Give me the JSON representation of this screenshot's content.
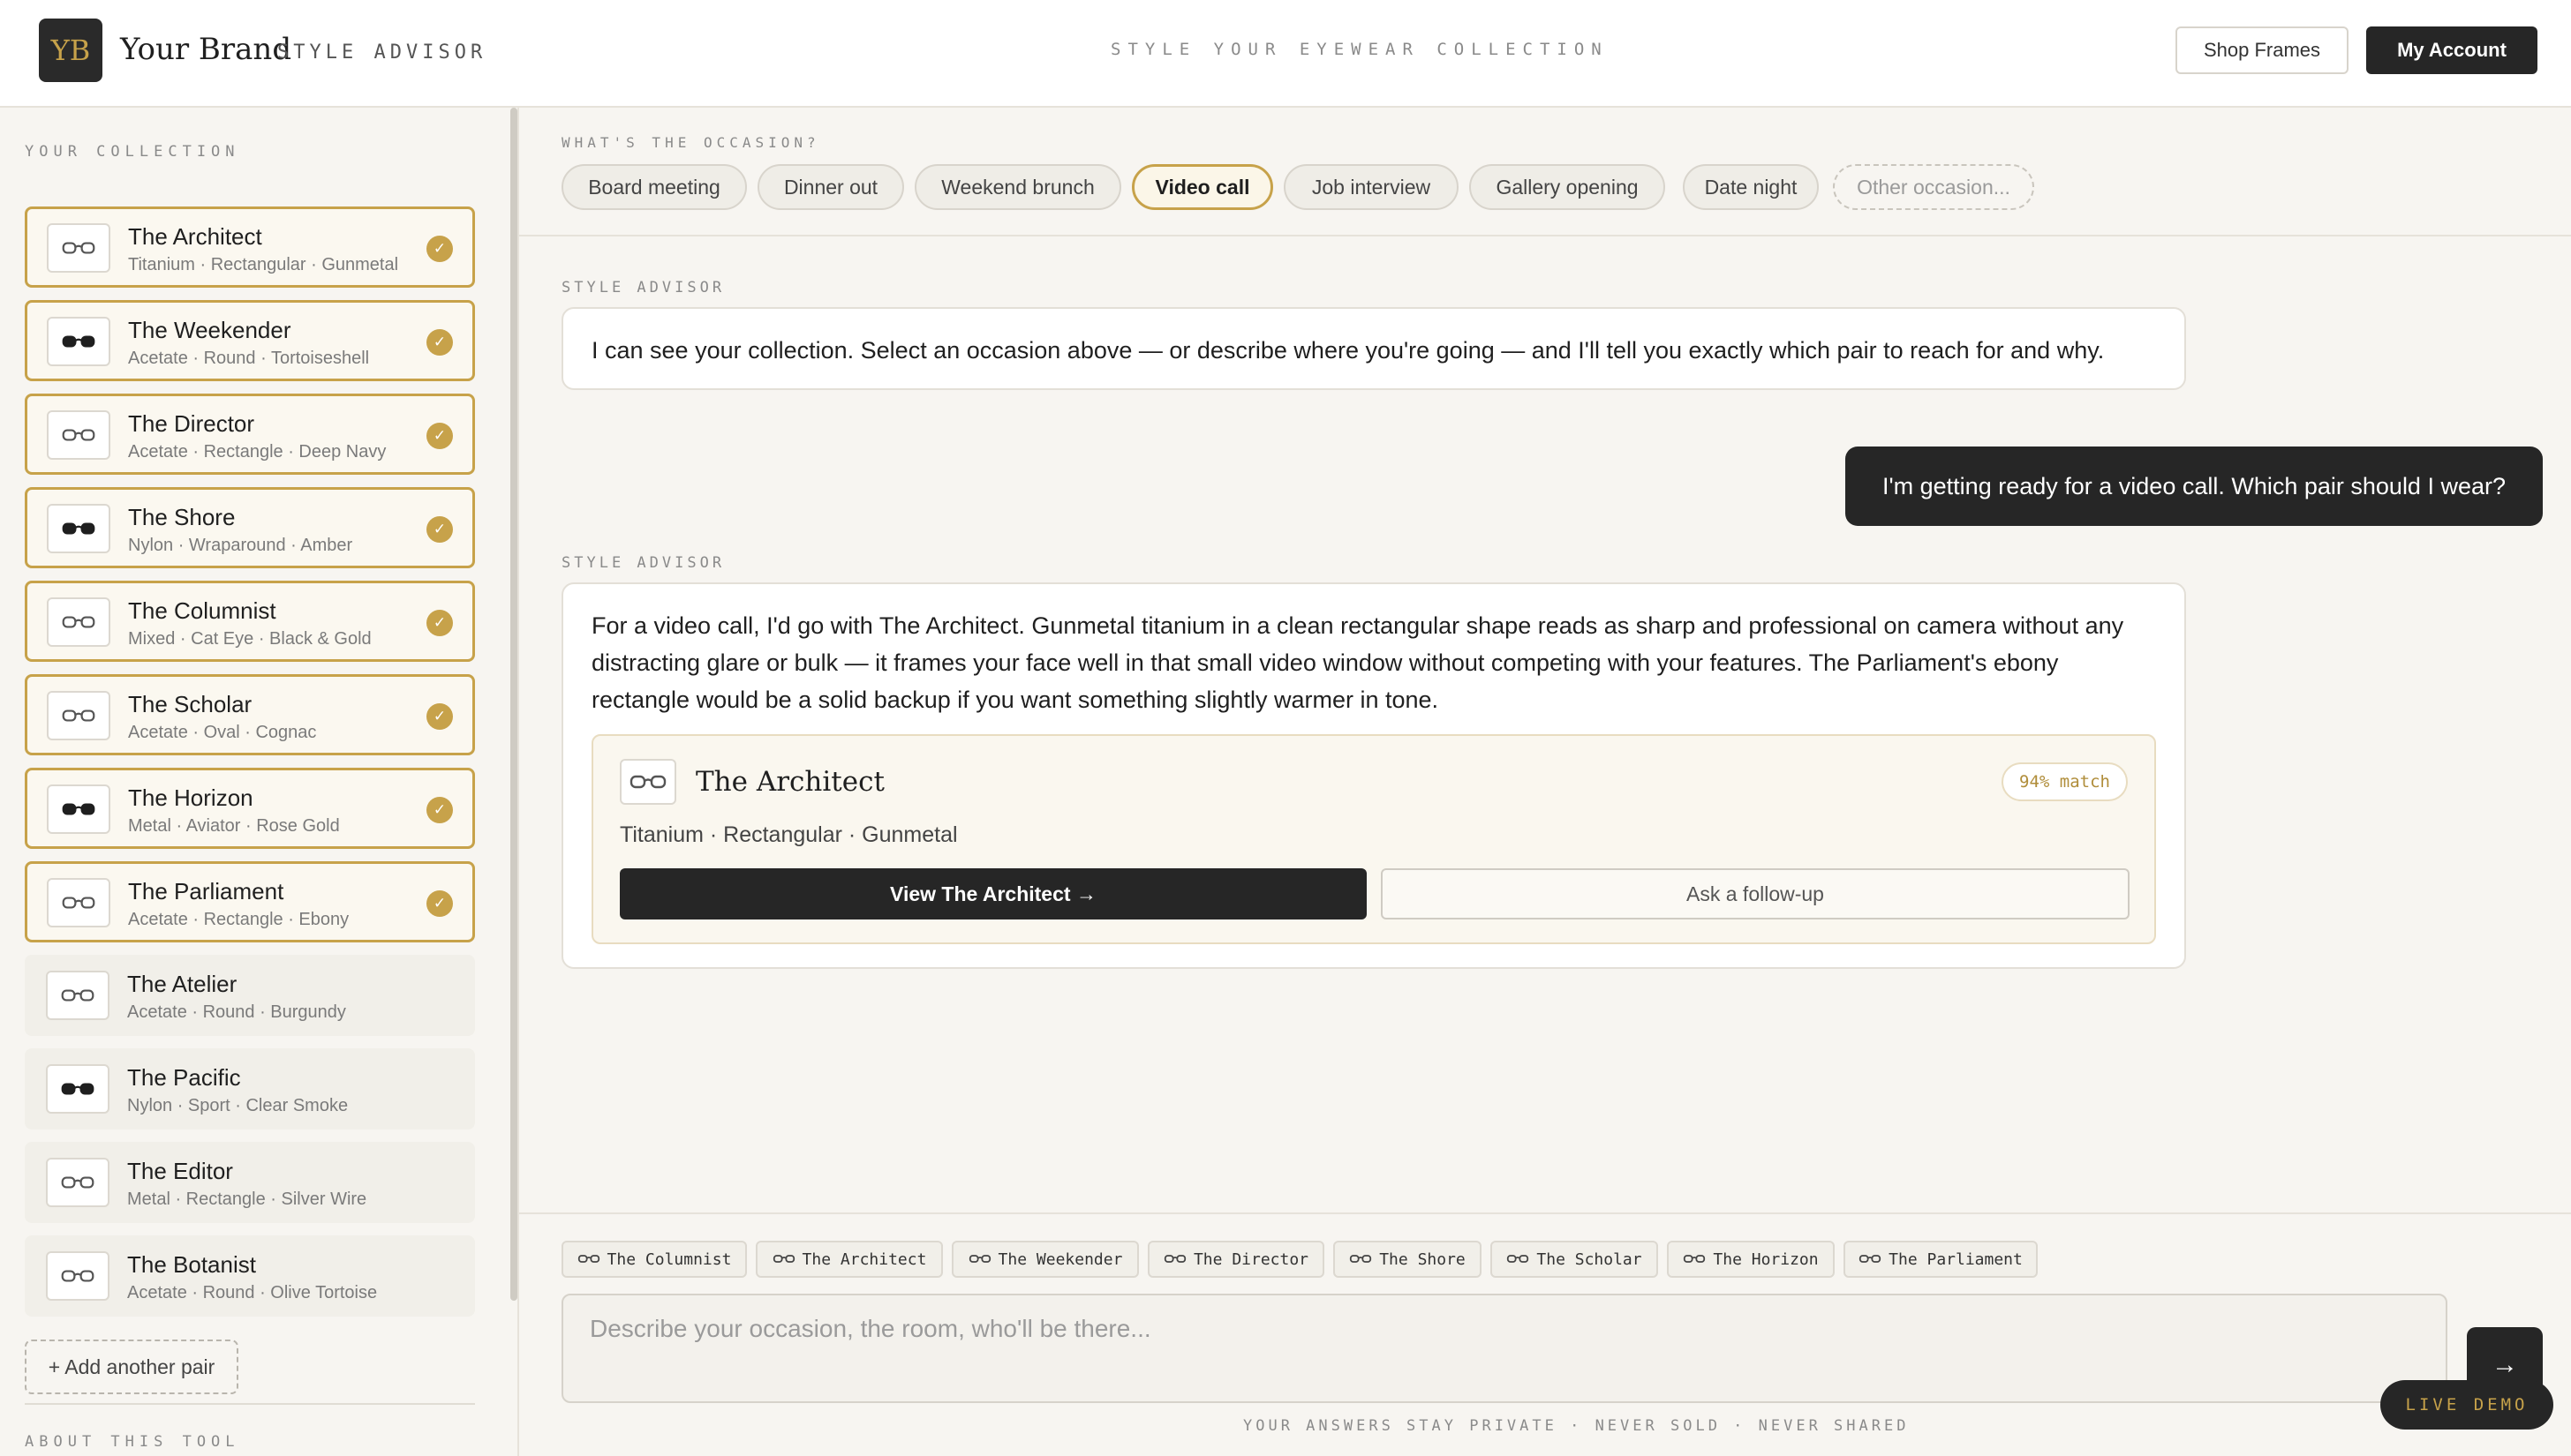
{
  "header": {
    "logo": "YB",
    "brand": "Your Brand",
    "sub": "STYLE ADVISOR",
    "tagline": "STYLE YOUR EYEWEAR COLLECTION",
    "shop_label": "Shop Frames",
    "account_label": "My Account"
  },
  "sidebar": {
    "collection_label": "YOUR COLLECTION",
    "items": [
      {
        "name": "The Architect",
        "meta": "Titanium · Rectangular · Gunmetal",
        "selected": true,
        "icon": "clear-glasses-icon"
      },
      {
        "name": "The Weekender",
        "meta": "Acetate · Round · Tortoiseshell",
        "selected": true,
        "icon": "sunglasses-icon"
      },
      {
        "name": "The Director",
        "meta": "Acetate · Rectangle · Deep Navy",
        "selected": true,
        "icon": "clear-glasses-icon"
      },
      {
        "name": "The Shore",
        "meta": "Nylon · Wraparound · Amber",
        "selected": true,
        "icon": "sunglasses-icon"
      },
      {
        "name": "The Columnist",
        "meta": "Mixed · Cat Eye · Black & Gold",
        "selected": true,
        "icon": "clear-glasses-icon"
      },
      {
        "name": "The Scholar",
        "meta": "Acetate · Oval · Cognac",
        "selected": true,
        "icon": "clear-glasses-icon"
      },
      {
        "name": "The Horizon",
        "meta": "Metal · Aviator · Rose Gold",
        "selected": true,
        "icon": "sunglasses-icon"
      },
      {
        "name": "The Parliament",
        "meta": "Acetate · Rectangle · Ebony",
        "selected": true,
        "icon": "clear-glasses-icon"
      },
      {
        "name": "The Atelier",
        "meta": "Acetate · Round · Burgundy",
        "selected": false,
        "icon": "clear-glasses-icon"
      },
      {
        "name": "The Pacific",
        "meta": "Nylon · Sport · Clear Smoke",
        "selected": false,
        "icon": "sunglasses-icon"
      },
      {
        "name": "The Editor",
        "meta": "Metal · Rectangle · Silver Wire",
        "selected": false,
        "icon": "clear-glasses-icon"
      },
      {
        "name": "The Botanist",
        "meta": "Acetate · Round · Olive Tortoise",
        "selected": false,
        "icon": "clear-glasses-icon"
      }
    ],
    "check_glyph": "✓",
    "add_label": "+ Add another pair",
    "about_label": "ABOUT THIS TOOL"
  },
  "occasion": {
    "label": "WHAT'S THE OCCASION?",
    "chips": [
      "Board meeting",
      "Dinner out",
      "Weekend brunch",
      "Video call",
      "Job interview",
      "Gallery opening",
      "Date night"
    ],
    "active": "Video call",
    "other_placeholder": "Other occasion..."
  },
  "chat": {
    "advisor_label": "STYLE ADVISOR",
    "intro": "I can see your collection. Select an occasion above — or describe where you're going — and I'll tell you exactly which pair to reach for and why.",
    "user_message": "I'm getting ready for a video call. Which pair should I wear?",
    "response": "For a video call, I'd go with The Architect. Gunmetal titanium in a clean rectangular shape reads as sharp and professional on camera without any distracting glare or bulk — it frames your face well in that small video window without competing with your features. The Parliament's ebony rectangle would be a solid backup if you want something slightly warmer in tone.",
    "recommendation": {
      "name": "The Architect",
      "match": "94% match",
      "meta": "Titanium · Rectangular · Gunmetal",
      "view_label": "View The Architect →",
      "follow_label": "Ask a follow-up"
    }
  },
  "composer": {
    "tags": [
      "The Columnist",
      "The Architect",
      "The Weekender",
      "The Director",
      "The Shore",
      "The Scholar",
      "The Horizon",
      "The Parliament"
    ],
    "placeholder": "Describe your occasion, the room, who'll be there...",
    "send_glyph": "→",
    "privacy": "YOUR ANSWERS STAY PRIVATE · NEVER SOLD · NEVER SHARED",
    "live_demo": "LIVE DEMO"
  },
  "colors": {
    "accent": "#c7a24a",
    "dark": "#262626",
    "background": "#f7f5f1"
  }
}
